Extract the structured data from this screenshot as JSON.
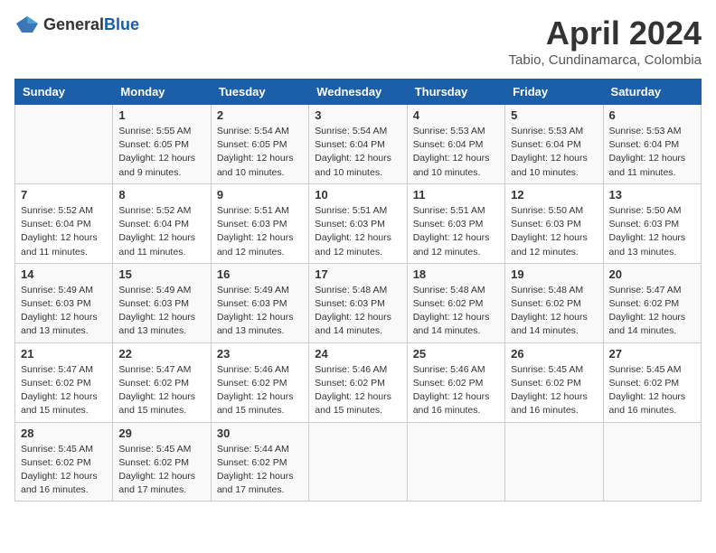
{
  "header": {
    "logo_general": "General",
    "logo_blue": "Blue",
    "month": "April 2024",
    "location": "Tabio, Cundinamarca, Colombia"
  },
  "weekdays": [
    "Sunday",
    "Monday",
    "Tuesday",
    "Wednesday",
    "Thursday",
    "Friday",
    "Saturday"
  ],
  "weeks": [
    [
      {
        "day": "",
        "sunrise": "",
        "sunset": "",
        "daylight": ""
      },
      {
        "day": "1",
        "sunrise": "Sunrise: 5:55 AM",
        "sunset": "Sunset: 6:05 PM",
        "daylight": "Daylight: 12 hours and 9 minutes."
      },
      {
        "day": "2",
        "sunrise": "Sunrise: 5:54 AM",
        "sunset": "Sunset: 6:05 PM",
        "daylight": "Daylight: 12 hours and 10 minutes."
      },
      {
        "day": "3",
        "sunrise": "Sunrise: 5:54 AM",
        "sunset": "Sunset: 6:04 PM",
        "daylight": "Daylight: 12 hours and 10 minutes."
      },
      {
        "day": "4",
        "sunrise": "Sunrise: 5:53 AM",
        "sunset": "Sunset: 6:04 PM",
        "daylight": "Daylight: 12 hours and 10 minutes."
      },
      {
        "day": "5",
        "sunrise": "Sunrise: 5:53 AM",
        "sunset": "Sunset: 6:04 PM",
        "daylight": "Daylight: 12 hours and 10 minutes."
      },
      {
        "day": "6",
        "sunrise": "Sunrise: 5:53 AM",
        "sunset": "Sunset: 6:04 PM",
        "daylight": "Daylight: 12 hours and 11 minutes."
      }
    ],
    [
      {
        "day": "7",
        "sunrise": "Sunrise: 5:52 AM",
        "sunset": "Sunset: 6:04 PM",
        "daylight": "Daylight: 12 hours and 11 minutes."
      },
      {
        "day": "8",
        "sunrise": "Sunrise: 5:52 AM",
        "sunset": "Sunset: 6:04 PM",
        "daylight": "Daylight: 12 hours and 11 minutes."
      },
      {
        "day": "9",
        "sunrise": "Sunrise: 5:51 AM",
        "sunset": "Sunset: 6:03 PM",
        "daylight": "Daylight: 12 hours and 12 minutes."
      },
      {
        "day": "10",
        "sunrise": "Sunrise: 5:51 AM",
        "sunset": "Sunset: 6:03 PM",
        "daylight": "Daylight: 12 hours and 12 minutes."
      },
      {
        "day": "11",
        "sunrise": "Sunrise: 5:51 AM",
        "sunset": "Sunset: 6:03 PM",
        "daylight": "Daylight: 12 hours and 12 minutes."
      },
      {
        "day": "12",
        "sunrise": "Sunrise: 5:50 AM",
        "sunset": "Sunset: 6:03 PM",
        "daylight": "Daylight: 12 hours and 12 minutes."
      },
      {
        "day": "13",
        "sunrise": "Sunrise: 5:50 AM",
        "sunset": "Sunset: 6:03 PM",
        "daylight": "Daylight: 12 hours and 13 minutes."
      }
    ],
    [
      {
        "day": "14",
        "sunrise": "Sunrise: 5:49 AM",
        "sunset": "Sunset: 6:03 PM",
        "daylight": "Daylight: 12 hours and 13 minutes."
      },
      {
        "day": "15",
        "sunrise": "Sunrise: 5:49 AM",
        "sunset": "Sunset: 6:03 PM",
        "daylight": "Daylight: 12 hours and 13 minutes."
      },
      {
        "day": "16",
        "sunrise": "Sunrise: 5:49 AM",
        "sunset": "Sunset: 6:03 PM",
        "daylight": "Daylight: 12 hours and 13 minutes."
      },
      {
        "day": "17",
        "sunrise": "Sunrise: 5:48 AM",
        "sunset": "Sunset: 6:03 PM",
        "daylight": "Daylight: 12 hours and 14 minutes."
      },
      {
        "day": "18",
        "sunrise": "Sunrise: 5:48 AM",
        "sunset": "Sunset: 6:02 PM",
        "daylight": "Daylight: 12 hours and 14 minutes."
      },
      {
        "day": "19",
        "sunrise": "Sunrise: 5:48 AM",
        "sunset": "Sunset: 6:02 PM",
        "daylight": "Daylight: 12 hours and 14 minutes."
      },
      {
        "day": "20",
        "sunrise": "Sunrise: 5:47 AM",
        "sunset": "Sunset: 6:02 PM",
        "daylight": "Daylight: 12 hours and 14 minutes."
      }
    ],
    [
      {
        "day": "21",
        "sunrise": "Sunrise: 5:47 AM",
        "sunset": "Sunset: 6:02 PM",
        "daylight": "Daylight: 12 hours and 15 minutes."
      },
      {
        "day": "22",
        "sunrise": "Sunrise: 5:47 AM",
        "sunset": "Sunset: 6:02 PM",
        "daylight": "Daylight: 12 hours and 15 minutes."
      },
      {
        "day": "23",
        "sunrise": "Sunrise: 5:46 AM",
        "sunset": "Sunset: 6:02 PM",
        "daylight": "Daylight: 12 hours and 15 minutes."
      },
      {
        "day": "24",
        "sunrise": "Sunrise: 5:46 AM",
        "sunset": "Sunset: 6:02 PM",
        "daylight": "Daylight: 12 hours and 15 minutes."
      },
      {
        "day": "25",
        "sunrise": "Sunrise: 5:46 AM",
        "sunset": "Sunset: 6:02 PM",
        "daylight": "Daylight: 12 hours and 16 minutes."
      },
      {
        "day": "26",
        "sunrise": "Sunrise: 5:45 AM",
        "sunset": "Sunset: 6:02 PM",
        "daylight": "Daylight: 12 hours and 16 minutes."
      },
      {
        "day": "27",
        "sunrise": "Sunrise: 5:45 AM",
        "sunset": "Sunset: 6:02 PM",
        "daylight": "Daylight: 12 hours and 16 minutes."
      }
    ],
    [
      {
        "day": "28",
        "sunrise": "Sunrise: 5:45 AM",
        "sunset": "Sunset: 6:02 PM",
        "daylight": "Daylight: 12 hours and 16 minutes."
      },
      {
        "day": "29",
        "sunrise": "Sunrise: 5:45 AM",
        "sunset": "Sunset: 6:02 PM",
        "daylight": "Daylight: 12 hours and 17 minutes."
      },
      {
        "day": "30",
        "sunrise": "Sunrise: 5:44 AM",
        "sunset": "Sunset: 6:02 PM",
        "daylight": "Daylight: 12 hours and 17 minutes."
      },
      {
        "day": "",
        "sunrise": "",
        "sunset": "",
        "daylight": ""
      },
      {
        "day": "",
        "sunrise": "",
        "sunset": "",
        "daylight": ""
      },
      {
        "day": "",
        "sunrise": "",
        "sunset": "",
        "daylight": ""
      },
      {
        "day": "",
        "sunrise": "",
        "sunset": "",
        "daylight": ""
      }
    ]
  ]
}
